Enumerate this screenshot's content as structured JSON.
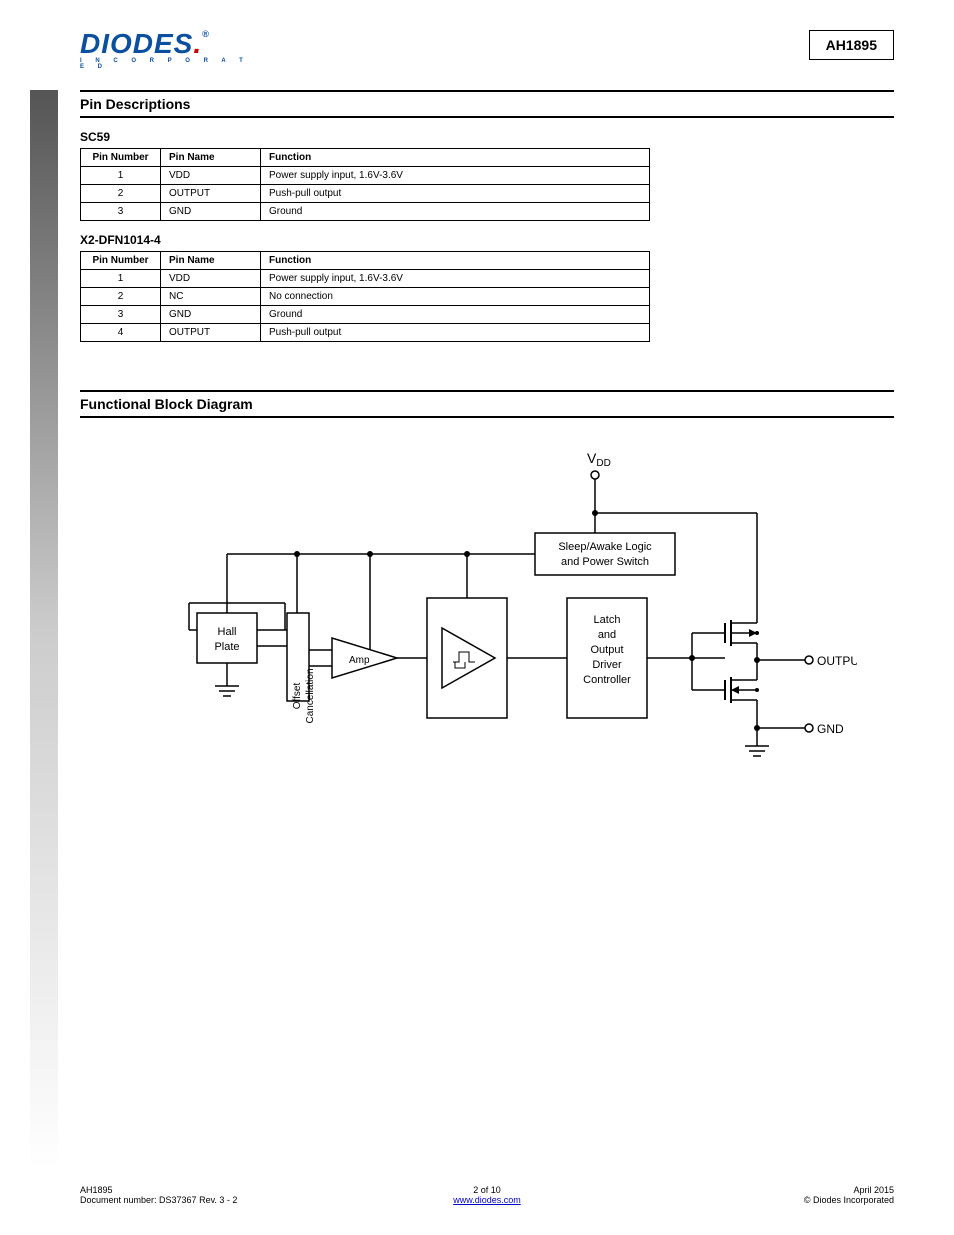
{
  "header": {
    "logo_top": "DIODES",
    "logo_bottom": "I N C O R P O R A T E D",
    "part_number": "AH1895"
  },
  "pin_desc": {
    "section_label": "Pin Descriptions",
    "sc59": {
      "label": "SC59",
      "headers": {
        "num": "Pin Number",
        "name": "Pin Name",
        "func": "Function"
      },
      "rows": [
        {
          "num": "1",
          "name": "VDD",
          "func": "Power supply input, 1.6V-3.6V"
        },
        {
          "num": "2",
          "name": "OUTPUT",
          "func": "Push-pull output"
        },
        {
          "num": "3",
          "name": "GND",
          "func": "Ground"
        }
      ]
    },
    "xdfn": {
      "label": "X2-DFN1014-4",
      "headers": {
        "num": "Pin Number",
        "name": "Pin Name",
        "func": "Function"
      },
      "rows": [
        {
          "num": "1",
          "name": "VDD",
          "func": "Power supply input, 1.6V-3.6V"
        },
        {
          "num": "2",
          "name": "NC",
          "func": "No connection"
        },
        {
          "num": "3",
          "name": "GND",
          "func": "Ground"
        },
        {
          "num": "4",
          "name": "OUTPUT",
          "func": "Push-pull output"
        }
      ]
    }
  },
  "block_diagram": {
    "section_label": "Functional Block Diagram",
    "labels": {
      "vdd": "VDD",
      "sleep_awake_1": "Sleep/Awake Logic",
      "sleep_awake_2": "and Power Switch",
      "hall_plate": "Hall\nPlate",
      "offset": "Offset\nCancellation",
      "amp": "Amp",
      "latch_1": "Latch",
      "latch_2": "and",
      "latch_3": "Output",
      "latch_4": "Driver",
      "latch_5": "Controller",
      "output": "OUTPUT",
      "gnd": "GND"
    }
  },
  "footer": {
    "left_1": "AH1895",
    "left_2": "Document number: DS37367 Rev. 3 - 2",
    "center_1": "2 of 10",
    "center_2": "www.diodes.com",
    "right_1": "April 2015",
    "right_2": "© Diodes Incorporated"
  }
}
